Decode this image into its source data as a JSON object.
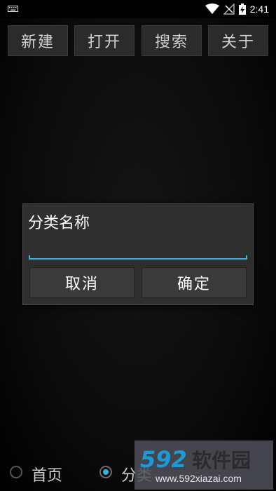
{
  "status_bar": {
    "time": "2:41",
    "icons": [
      "keyboard-icon",
      "wifi-icon",
      "no-signal-icon",
      "battery-charging-icon"
    ]
  },
  "toolbar": {
    "new_label": "新建",
    "open_label": "打开",
    "search_label": "搜索",
    "about_label": "关于"
  },
  "dialog": {
    "title": "分类名称",
    "input_value": "",
    "cancel_label": "取消",
    "confirm_label": "确定"
  },
  "bottom_tabs": {
    "items": [
      {
        "label": "首页",
        "selected": false
      },
      {
        "label": "分类",
        "selected": true
      }
    ]
  },
  "watermark": {
    "logo_text": "592软件园",
    "url": "www.592xiazai.com"
  },
  "colors": {
    "accent": "#33b5e5",
    "button_bg": "#2b2b2b",
    "dialog_bg": "#2f2f2f"
  }
}
